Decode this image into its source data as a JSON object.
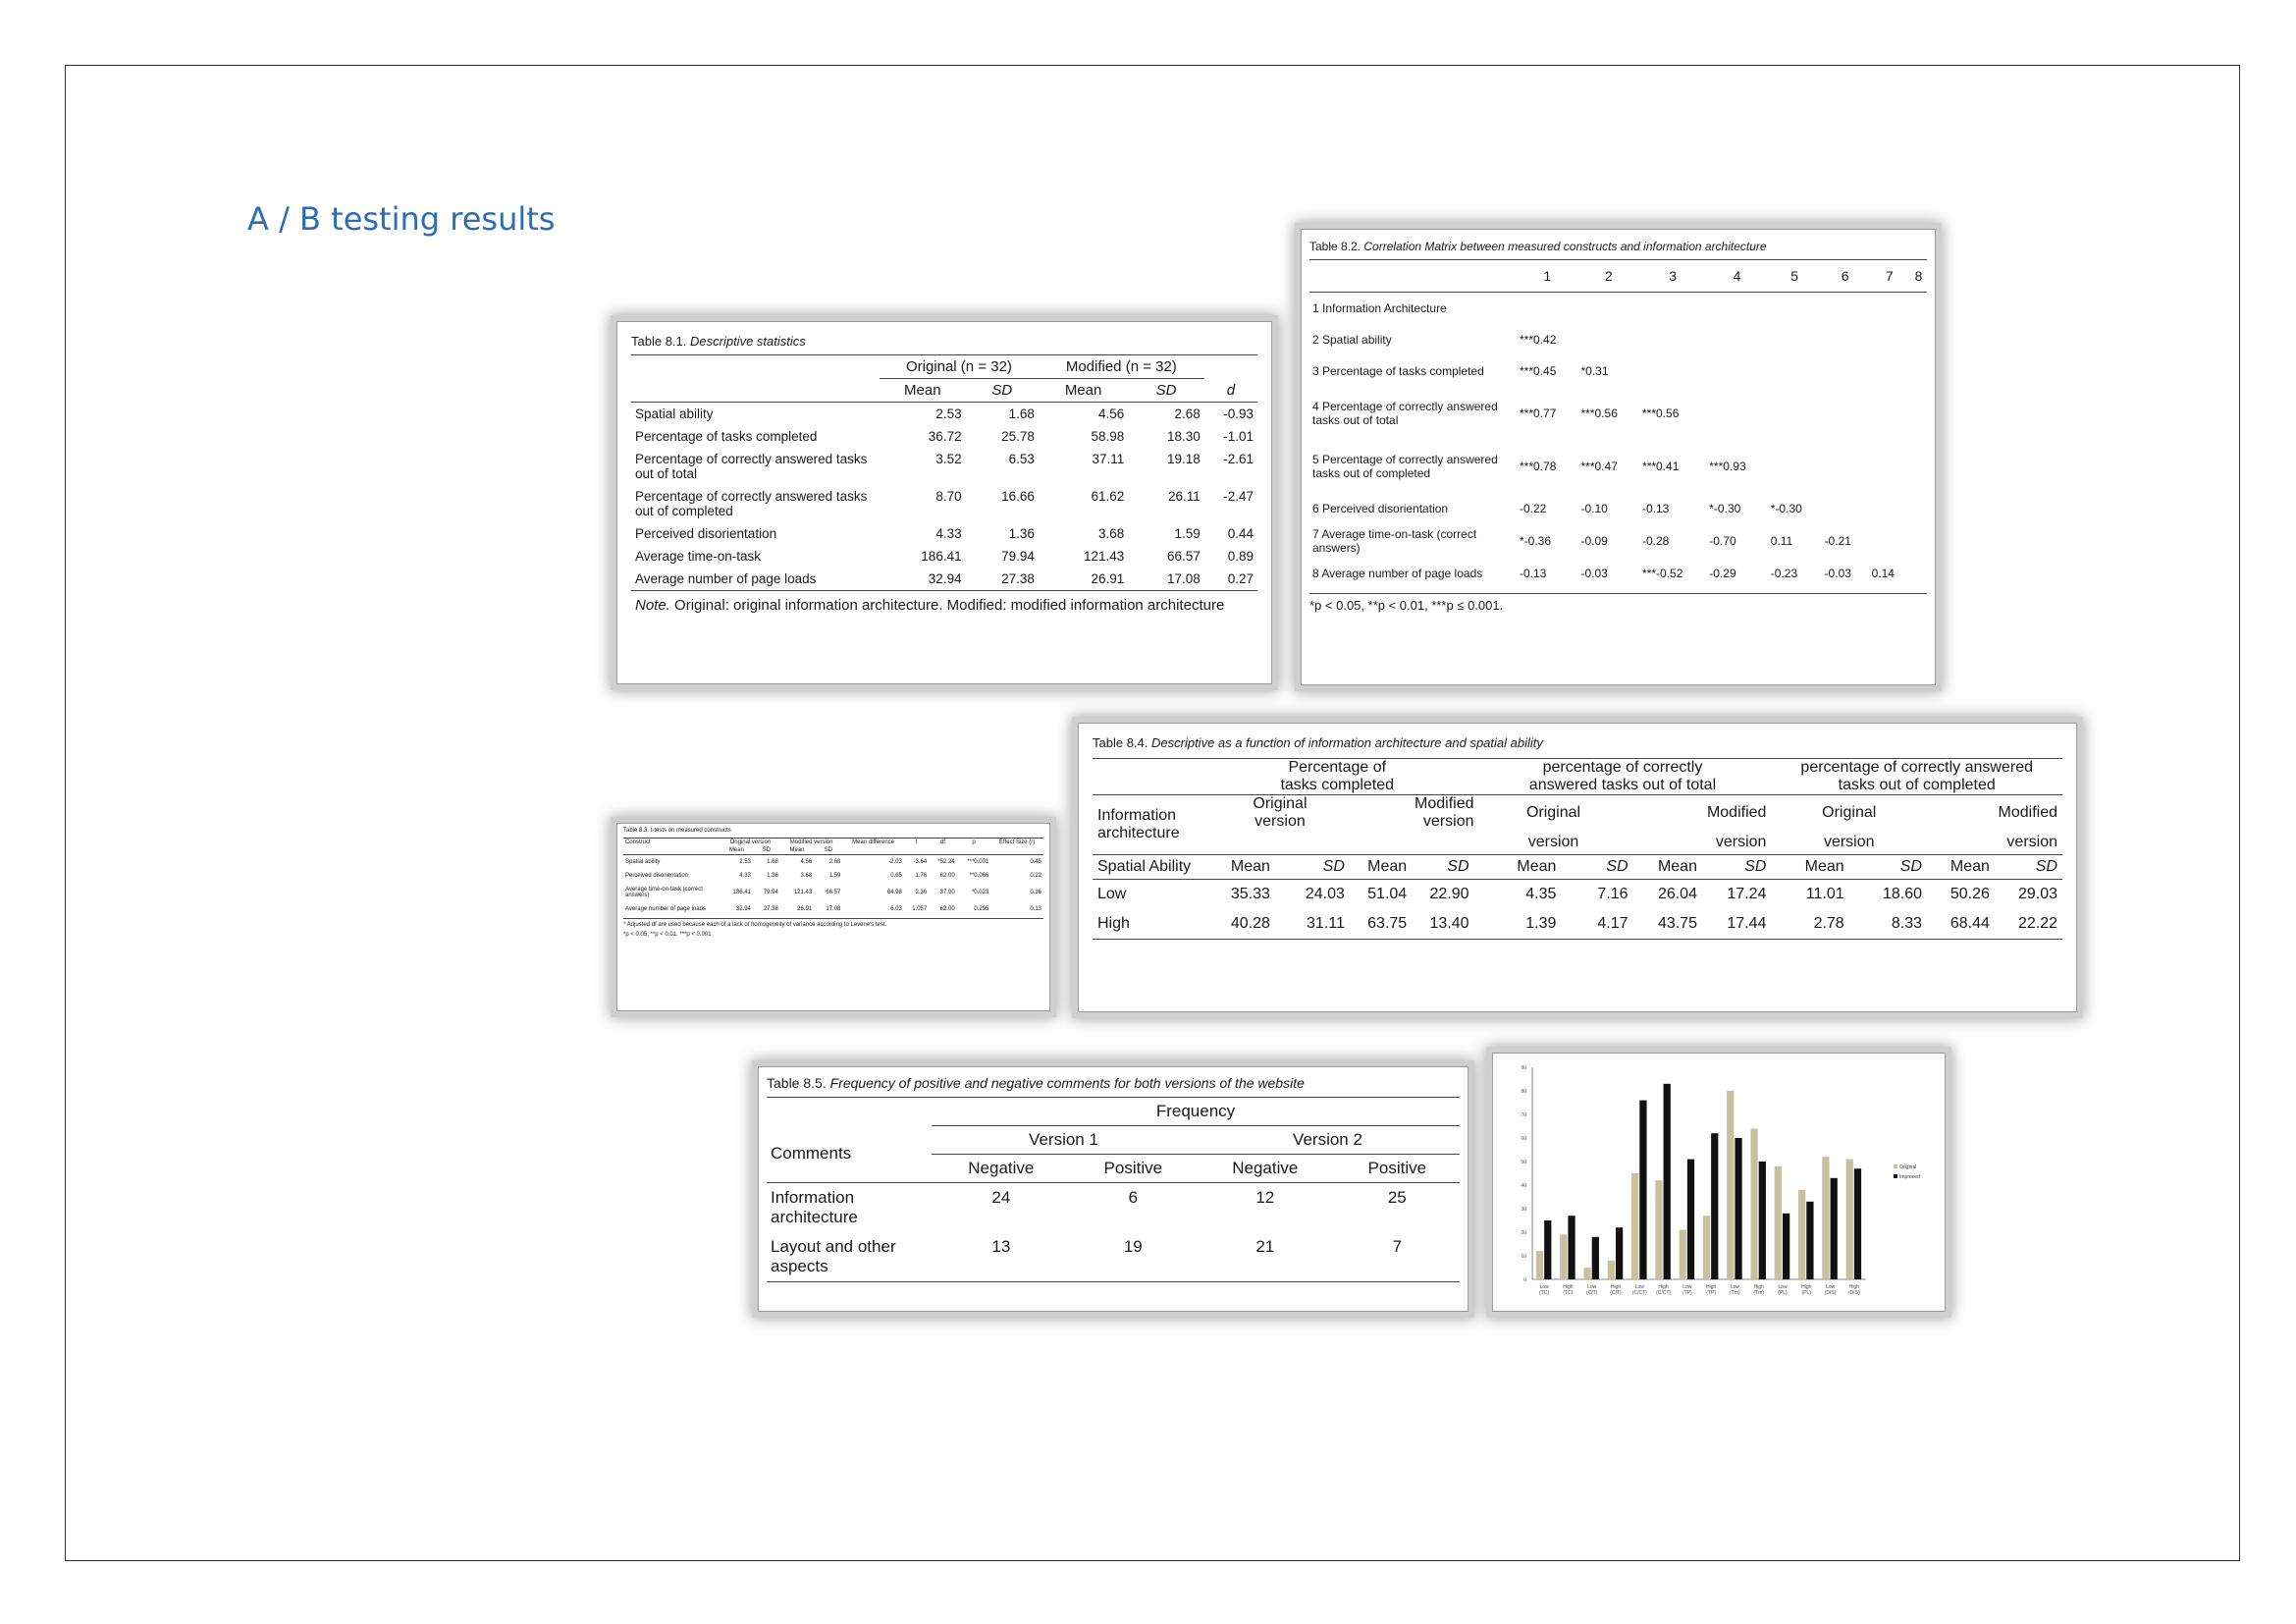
{
  "page": {
    "title": "A / B testing results"
  },
  "t81": {
    "caption_label": "Table 8.1. ",
    "caption_title": "Descriptive statistics",
    "group1": "Original (n = 32)",
    "group2": "Modified (n = 32)",
    "mean": "Mean",
    "sd": "SD",
    "d": "d",
    "rows": [
      [
        "Spatial ability",
        "2.53",
        "1.68",
        "4.56",
        "2.68",
        "-0.93"
      ],
      [
        "Percentage of tasks completed",
        "36.72",
        "25.78",
        "58.98",
        "18.30",
        "-1.01"
      ],
      [
        "Percentage of correctly answered tasks out of total",
        "3.52",
        "6.53",
        "37.11",
        "19.18",
        "-2.61"
      ],
      [
        "Percentage of correctly answered tasks out of completed",
        "8.70",
        "16.66",
        "61.62",
        "26.11",
        "-2.47"
      ],
      [
        "Perceived disorientation",
        "4.33",
        "1.36",
        "3.68",
        "1.59",
        "0.44"
      ],
      [
        "Average time-on-task",
        "186.41",
        "79.94",
        "121.43",
        "66.57",
        "0.89"
      ],
      [
        "Average number of page loads",
        "32.94",
        "27.38",
        "26.91",
        "17.08",
        "0.27"
      ]
    ],
    "note_label": "Note.",
    "note_text": " Original: original information architecture. Modified: modified information architecture"
  },
  "t82": {
    "caption_label": "Table 8.2. ",
    "caption_title": "Correlation Matrix between measured constructs and information architecture",
    "cols": [
      "1",
      "2",
      "3",
      "4",
      "5",
      "6",
      "7",
      "8"
    ],
    "rows": [
      [
        "1 Information Architecture",
        "",
        "",
        "",
        "",
        "",
        "",
        "",
        ""
      ],
      [
        "2 Spatial ability",
        "***0.42",
        "",
        "",
        "",
        "",
        "",
        "",
        ""
      ],
      [
        "3 Percentage of tasks completed",
        "***0.45",
        "*0.31",
        "",
        "",
        "",
        "",
        "",
        ""
      ],
      [
        "4 Percentage of correctly answered tasks out of total",
        "***0.77",
        "***0.56",
        "***0.56",
        "",
        "",
        "",
        "",
        ""
      ],
      [
        "5 Percentage of correctly answered tasks out of completed",
        "***0.78",
        "***0.47",
        "***0.41",
        "***0.93",
        "",
        "",
        "",
        ""
      ],
      [
        "6 Perceived disorientation",
        "-0.22",
        "-0.10",
        "-0.13",
        "*-0.30",
        "*-0.30",
        "",
        "",
        ""
      ],
      [
        "7 Average time-on-task (correct answers)",
        "*-0.36",
        "-0.09",
        "-0.28",
        "-0.70",
        "0.11",
        "-0.21",
        "",
        ""
      ],
      [
        "8 Average number of page loads",
        "-0.13",
        "-0.03",
        "***-0.52",
        "-0.29",
        "-0.23",
        "-0.03",
        "0.14",
        ""
      ]
    ],
    "footnote": "*p < 0.05, **p < 0.01, ***p ≤ 0.001."
  },
  "t83": {
    "caption": "Table 8.3. t-tests on measured constructs",
    "headers": [
      "Construct",
      "Original version",
      "Modified version",
      "Mean difference",
      "t",
      "df",
      "p",
      "Effect Size (r)"
    ],
    "subheaders": [
      "Mean",
      "SD",
      "Mean",
      "SD"
    ],
    "rows": [
      [
        "Spatial ability",
        "2.53",
        "1.68",
        "4.56",
        "2.68",
        "-2.03",
        "-3.64",
        "*52.24",
        "***0.001",
        "0.45"
      ],
      [
        "Perceived disorientation",
        "4.33",
        "1.36",
        "3.68",
        "1.59",
        "0.65",
        "1.76",
        "62.00",
        "**0.066",
        "0.22"
      ],
      [
        "Average time-on-task (correct answers)",
        "186.41",
        "79.94",
        "121.43",
        "66.57",
        "64.98",
        "2.36",
        "37.00",
        "*0.023",
        "0.36"
      ],
      [
        "Average number of page loads",
        "32.94",
        "27.38",
        "26.91",
        "17.08",
        "6.03",
        "1.057",
        "62.00",
        "0.295",
        "0.13"
      ]
    ],
    "footnote1": "* Adjusted df are used because each of a lack of homogeneity of variance according to Levene's test.",
    "footnote2": "*p < 0.05, **p < 0.01, ***p < 0.001"
  },
  "t84": {
    "caption_label": "Table 8.4. ",
    "caption_title": "Descriptive as a function of information architecture and spatial ability",
    "group_heads": [
      "Percentage of tasks completed",
      "percentage of correctly answered tasks out of total",
      "percentage of correctly answered tasks out of completed"
    ],
    "ia_label": "Information architecture",
    "original": "Original version",
    "modified": "Modified version",
    "original_a": "Original",
    "original_b": "version",
    "modified_a": "Modified",
    "modified_b": "version",
    "spatial": "Spatial Ability",
    "mean": "Mean",
    "sd": "SD",
    "rows": [
      [
        "Low",
        "35.33",
        "24.03",
        "51.04",
        "22.90",
        "4.35",
        "7.16",
        "26.04",
        "17.24",
        "11.01",
        "18.60",
        "50.26",
        "29.03"
      ],
      [
        "High",
        "40.28",
        "31.11",
        "63.75",
        "13.40",
        "1.39",
        "4.17",
        "43.75",
        "17.44",
        "2.78",
        "8.33",
        "68.44",
        "22.22"
      ]
    ]
  },
  "t85": {
    "caption_label": "Table 8.5. ",
    "caption_title": "Frequency of positive and negative comments for both versions of the website",
    "frequency": "Frequency",
    "comments": "Comments",
    "v1": "Version 1",
    "v2": "Version 2",
    "negative": "Negative",
    "positive": "Positive",
    "rows": [
      [
        "Information architecture",
        "24",
        "6",
        "12",
        "25"
      ],
      [
        "Layout and other aspects",
        "13",
        "19",
        "21",
        "7"
      ]
    ]
  },
  "chart_data": {
    "type": "bar",
    "categories": [
      "Low (TC)",
      "High (TC)",
      "Low (C/T)",
      "High (C/T)",
      "Low (C/CT)",
      "High (C/CT)",
      "Low (TP)",
      "High (TP)",
      "Low (Tm)",
      "High (Tm)",
      "Low (PL)",
      "High (PL)",
      "Low (DIS)",
      "High (DIS)"
    ],
    "series": [
      {
        "name": "Original",
        "values": [
          12,
          19,
          5,
          8,
          45,
          42,
          21,
          27,
          80,
          64,
          48,
          38,
          52,
          51
        ],
        "color": "#c9c0a0"
      },
      {
        "name": "Improved",
        "values": [
          25,
          27,
          18,
          22,
          76,
          83,
          51,
          62,
          60,
          50,
          28,
          33,
          43,
          47
        ],
        "color": "#111111"
      }
    ],
    "yticks": [
      "0",
      "10",
      "20",
      "30",
      "40",
      "50",
      "60",
      "70",
      "80",
      "90"
    ],
    "ylim": [
      0,
      90
    ],
    "legend": "right"
  }
}
